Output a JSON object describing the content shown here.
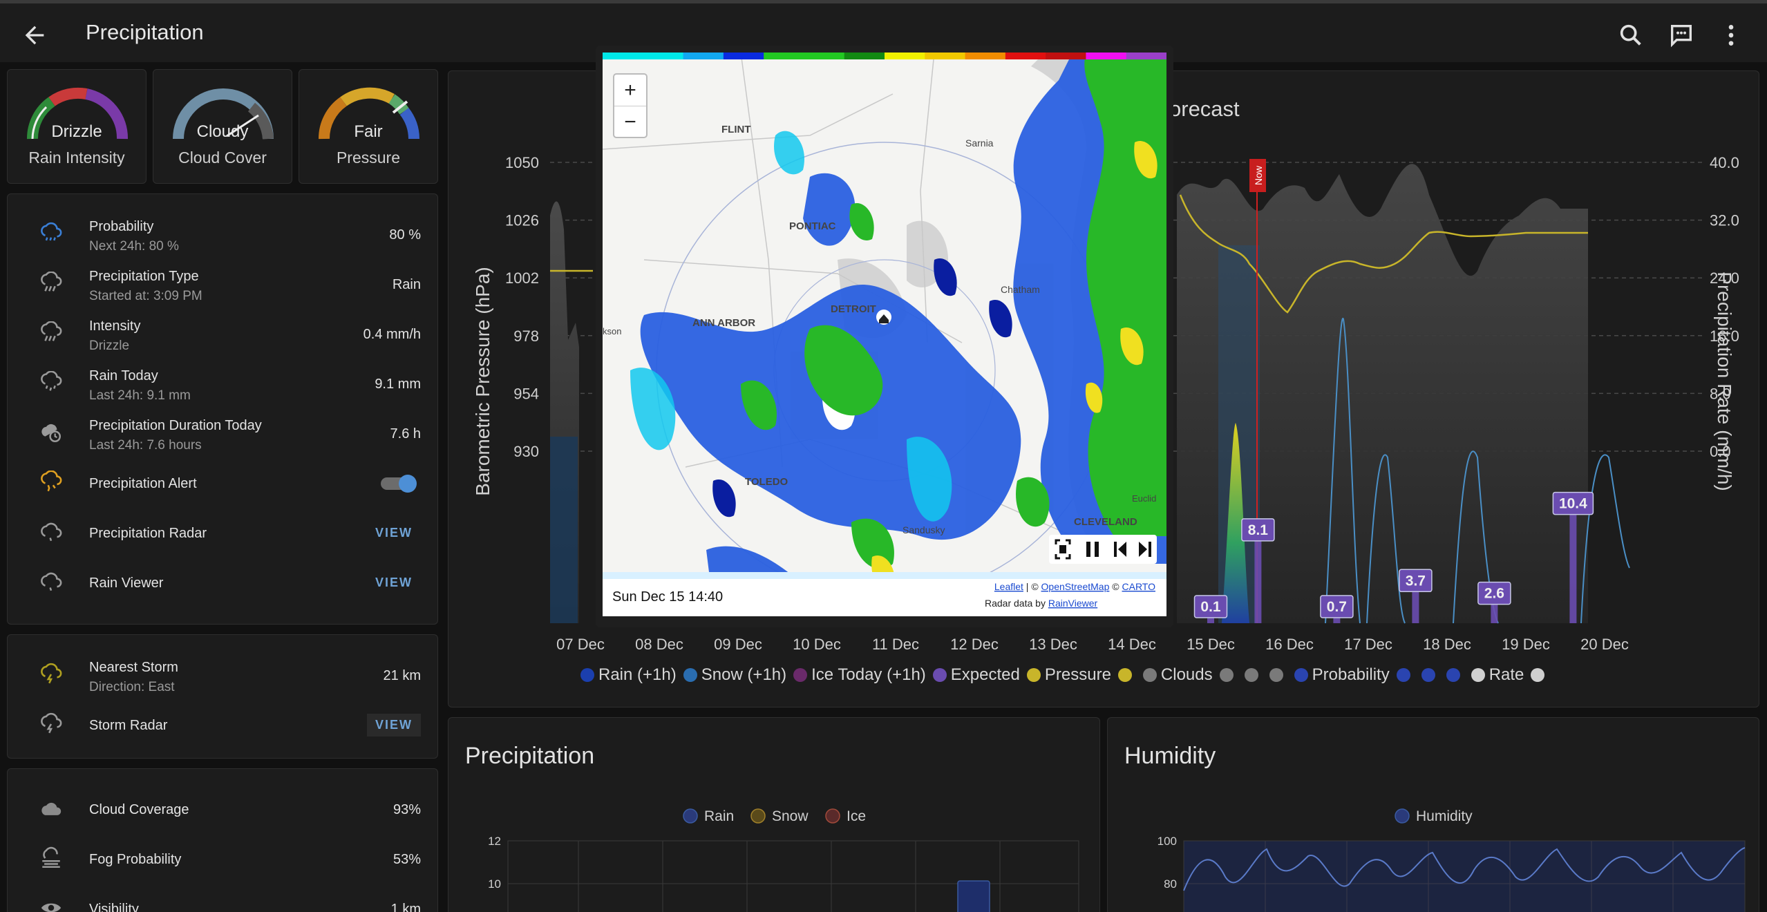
{
  "appbar": {
    "title": "Precipitation"
  },
  "gauges": [
    {
      "value": "Drizzle",
      "label": "Rain Intensity"
    },
    {
      "value": "Cloudy",
      "label": "Cloud Cover"
    },
    {
      "value": "Fair",
      "label": "Pressure"
    }
  ],
  "precip_list": [
    {
      "name": "Probability",
      "sub": "Next 24h: 80 %",
      "value": "80 %"
    },
    {
      "name": "Precipitation Type",
      "sub": "Started at: 3:09 PM",
      "value": "Rain"
    },
    {
      "name": "Intensity",
      "sub": "Drizzle",
      "value": "0.4 mm/h"
    },
    {
      "name": "Rain Today",
      "sub": "Last 24h: 9.1 mm",
      "value": "9.1 mm"
    },
    {
      "name": "Precipitation Duration Today",
      "sub": "Last 24h: 7.6 hours",
      "value": "7.6 h"
    },
    {
      "name": "Precipitation Alert",
      "toggle": true
    },
    {
      "name": "Precipitation Radar",
      "button": "VIEW"
    },
    {
      "name": "Rain Viewer",
      "button": "VIEW"
    }
  ],
  "storm_list": [
    {
      "name": "Nearest Storm",
      "sub": "Direction: East",
      "value": "21 km"
    },
    {
      "name": "Storm Radar",
      "button": "VIEW"
    }
  ],
  "cloud_list": [
    {
      "name": "Cloud Coverage",
      "value": "93%"
    },
    {
      "name": "Fog Probability",
      "value": "53%"
    },
    {
      "name": "Visibility",
      "value": "1 km"
    }
  ],
  "forecast_chart": {
    "title_visible": "orecast",
    "now_label": "Now",
    "left_axis_label": "Barometric Pressure (hPa)",
    "right_axis_label": "Precipitation Rate (mm/h)",
    "left_ticks": [
      "1050",
      "1026",
      "1002",
      "978",
      "954",
      "930"
    ],
    "right_ticks": [
      "40.0",
      "32.0",
      "24.0",
      "16.0",
      "8.0",
      "0.0"
    ],
    "x_ticks": [
      "07 Dec",
      "08 Dec",
      "09 Dec",
      "10 Dec",
      "11 Dec",
      "12 Dec",
      "13 Dec",
      "14 Dec",
      "15 Dec",
      "16 Dec",
      "17 Dec",
      "18 Dec",
      "19 Dec",
      "20 Dec"
    ],
    "bar_labels": [
      {
        "day_index": 8,
        "value": "0.1"
      },
      {
        "day_index": 8.6,
        "value": "8.1"
      },
      {
        "day_index": 9.6,
        "value": "0.7"
      },
      {
        "day_index": 10.6,
        "value": "3.7"
      },
      {
        "day_index": 11.6,
        "value": "2.6"
      },
      {
        "day_index": 12.6,
        "value": "10.4"
      }
    ],
    "legend": [
      {
        "label": "Rain (+1h)",
        "color": "#1b3fae"
      },
      {
        "label": "Snow (+1h)",
        "color": "#2a6db0"
      },
      {
        "label": "Ice Today (+1h)",
        "color": "#6a2a6a"
      },
      {
        "label": "Expected",
        "color": "#6a4cb0"
      },
      {
        "label": "Pressure",
        "color": "#c8b52a"
      },
      {
        "label": "",
        "color": "#c8b52a"
      },
      {
        "label": "Clouds",
        "color": "#7a7a7a"
      },
      {
        "label": "",
        "color": "#7a7a7a"
      },
      {
        "label": "",
        "color": "#7a7a7a"
      },
      {
        "label": "",
        "color": "#7a7a7a"
      },
      {
        "label": "Probability",
        "color": "#2a44b0"
      },
      {
        "label": "",
        "color": "#2a44b0"
      },
      {
        "label": "",
        "color": "#2a44b0"
      },
      {
        "label": "",
        "color": "#2a44b0"
      },
      {
        "label": "Rate",
        "color": "#cfcfcf"
      },
      {
        "label": "",
        "color": "#cfcfcf"
      }
    ]
  },
  "chart_data": [
    {
      "type": "line",
      "title": "",
      "ylabel": "Barometric Pressure (hPa)",
      "y2label": "Precipitation Rate (mm/h)",
      "ylim": [
        930,
        1050
      ],
      "y2lim": [
        0,
        40
      ],
      "x": [
        "15 Dec",
        "16 Dec",
        "17 Dec",
        "18 Dec",
        "19 Dec",
        "20 Dec"
      ],
      "series": [
        {
          "name": "Pressure",
          "values": [
            1030,
            1018,
            1008,
            1022,
            1030,
            1030
          ]
        },
        {
          "name": "Expected",
          "values": [
            0.1,
            8.1,
            0.7,
            3.7,
            2.6,
            10.4
          ]
        }
      ]
    },
    {
      "type": "bar",
      "title": "Precipitation",
      "ylim": [
        0,
        12
      ],
      "y_ticks": [
        "12",
        "10"
      ],
      "series": [
        {
          "name": "Rain",
          "color": "#2a44b0"
        },
        {
          "name": "Snow",
          "color": "#b08a2a"
        },
        {
          "name": "Ice",
          "color": "#b04a3a"
        }
      ]
    },
    {
      "type": "area",
      "title": "Humidity",
      "ylim": [
        60,
        100
      ],
      "y_ticks": [
        "100",
        "80"
      ],
      "series": [
        {
          "name": "Humidity",
          "color": "#2a44b0"
        }
      ]
    }
  ],
  "map": {
    "timestamp": "Sun Dec 15 14:40",
    "zoom_in": "+",
    "zoom_out": "−",
    "attribution_line1": [
      "Leaflet",
      " | © ",
      "OpenStreetMap",
      " © ",
      "CARTO"
    ],
    "attribution_line2": [
      "Radar data by ",
      "RainViewer"
    ],
    "places": [
      "FLINT",
      "Sarnia",
      "PONTIAC",
      "DETROIT",
      "Chatham",
      "ANN ARBOR",
      "kson",
      "TOLEDO",
      "Sandusky",
      "Euclid",
      "CLEVELAND"
    ]
  },
  "precipitation_card": {
    "title": "Precipitation",
    "legend": [
      "Rain",
      "Snow",
      "Ice"
    ]
  },
  "humidity_card": {
    "title": "Humidity",
    "legend": [
      "Humidity"
    ]
  }
}
